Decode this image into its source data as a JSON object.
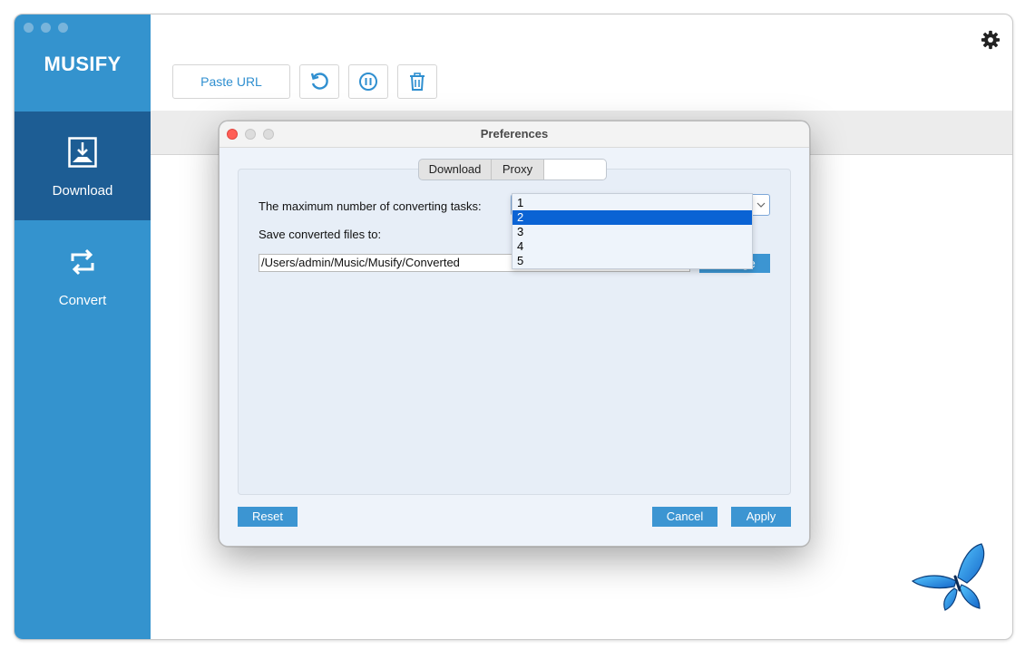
{
  "app": {
    "logo": "MUSIFY"
  },
  "sidebar": {
    "items": [
      {
        "label": "Download",
        "icon": "download-icon",
        "active": true
      },
      {
        "label": "Convert",
        "icon": "convert-icon",
        "active": false
      }
    ]
  },
  "toolbar": {
    "paste_url_label": "Paste URL",
    "icons": [
      "refresh-icon",
      "pause-icon",
      "trash-icon"
    ]
  },
  "dialog": {
    "title": "Preferences",
    "tabs": [
      "Download",
      "Proxy",
      ""
    ],
    "max_tasks_label": "The maximum number of converting tasks:",
    "save_label": "Save converted files to:",
    "save_path": "/Users/admin/Music/Musify/Converted",
    "change_button": "Change",
    "select": {
      "options": [
        "1",
        "2",
        "3",
        "4",
        "5"
      ],
      "highlighted": "2"
    },
    "buttons": {
      "reset": "Reset",
      "cancel": "Cancel",
      "apply": "Apply"
    }
  },
  "colors": {
    "sidebar": "#3493ce",
    "sidebar_active": "#1d5d94",
    "accent": "#3c95d2",
    "selection": "#0a63d4"
  }
}
